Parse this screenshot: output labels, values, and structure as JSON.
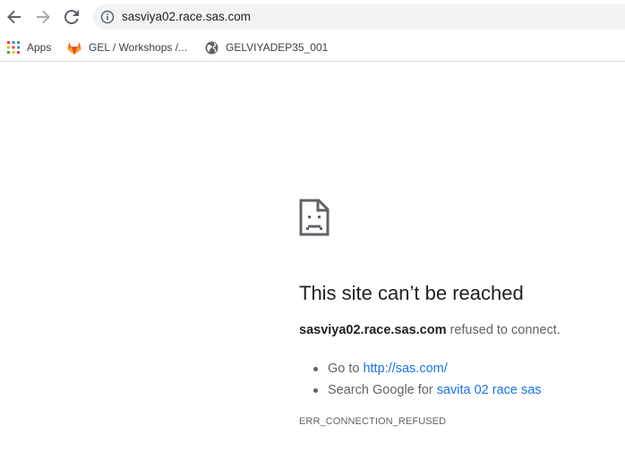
{
  "address_bar": {
    "url": "sasviya02.race.sas.com"
  },
  "bookmarks": [
    {
      "label": "Apps",
      "icon": "apps-grid-icon"
    },
    {
      "label": "GEL / Workshops /...",
      "icon": "gitlab-icon"
    },
    {
      "label": "GELVIYADEP35_001",
      "icon": "globe-icon"
    }
  ],
  "error_page": {
    "title": "This site can’t be reached",
    "host": "sasviya02.race.sas.com",
    "message_suffix": "refused to connect.",
    "suggestions": [
      {
        "prefix": "Go to",
        "link": "http://sas.com/"
      },
      {
        "prefix": "Search Google for",
        "link": "savita 02 race sas"
      }
    ],
    "error_code": "ERR_CONNECTION_REFUSED"
  },
  "colors": {
    "link": "#1a73e8",
    "omnibox_bg": "#f1f3f4",
    "text": "#202124",
    "secondary_text": "#5f6368"
  }
}
